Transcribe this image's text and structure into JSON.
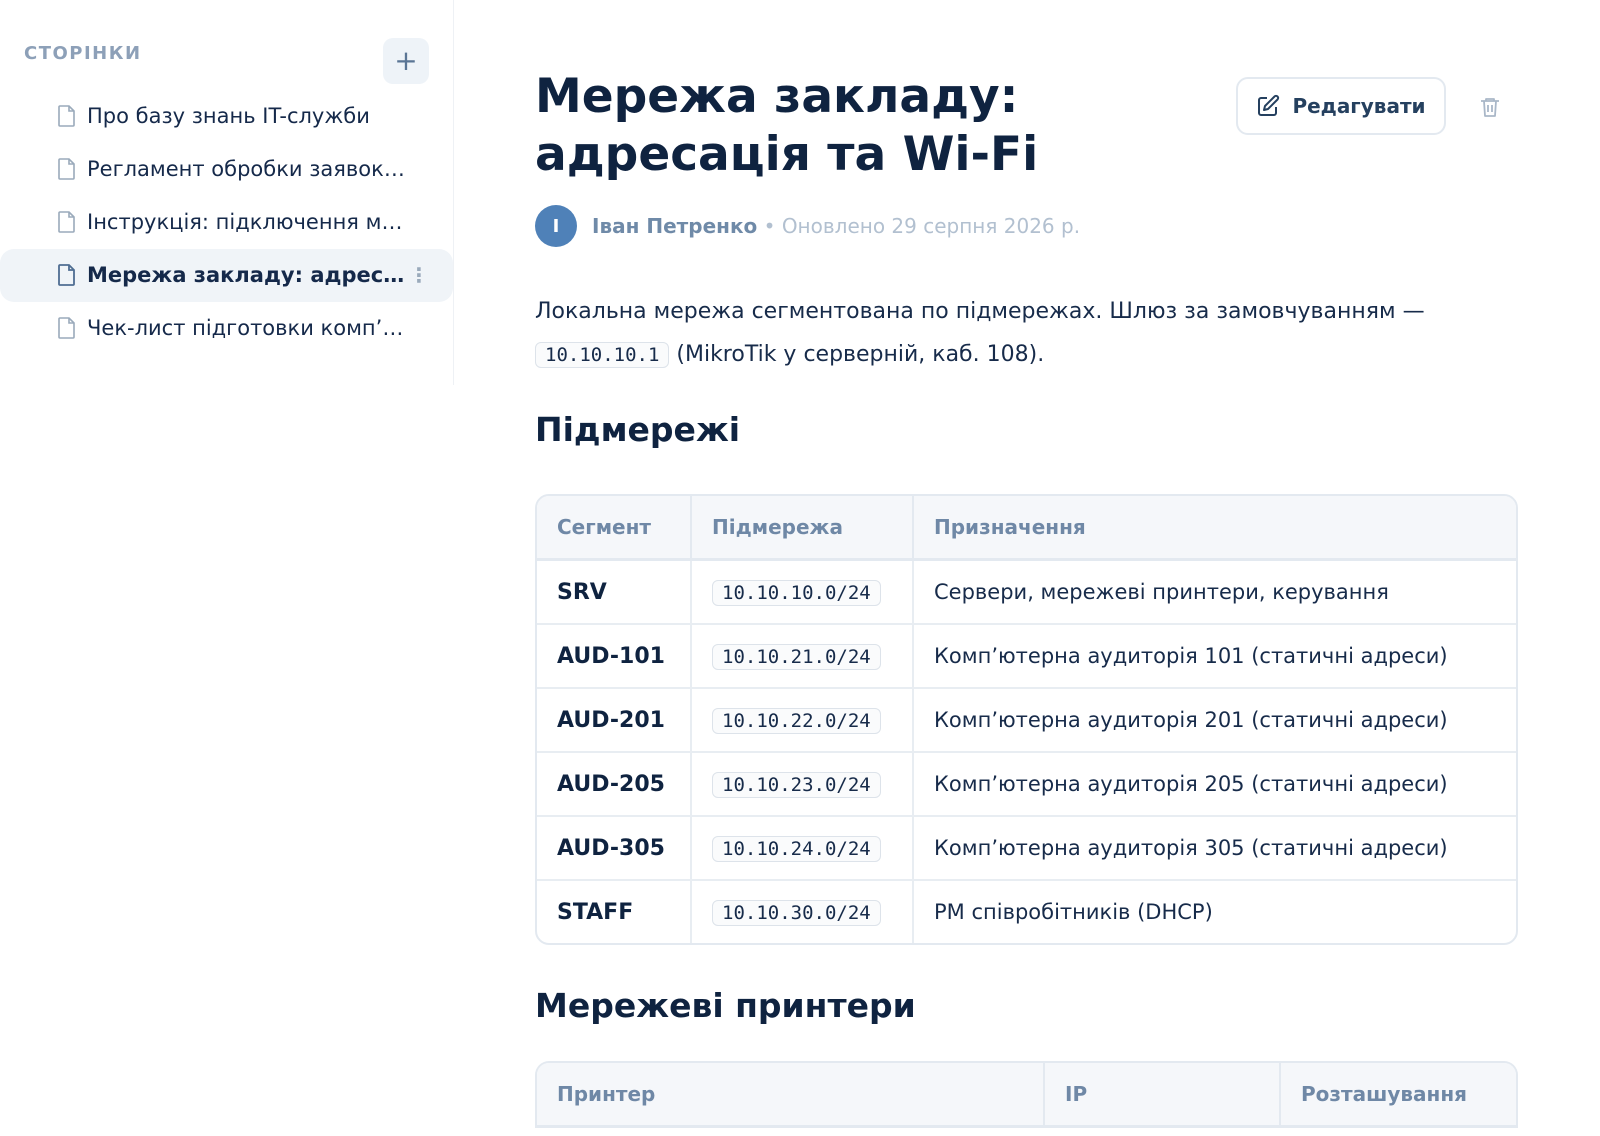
{
  "sidebar": {
    "title": "СТОРІНКИ",
    "add_label": "+",
    "items": [
      {
        "label": "Про базу знань IT-служби"
      },
      {
        "label": "Регламент обробки заявок …"
      },
      {
        "label": "Інструкція: підключення ме…"
      },
      {
        "label": "Мережа закладу: адресац…",
        "active": true
      },
      {
        "label": "Чек-лист підготовки комп’…"
      }
    ],
    "more_label": "⋮"
  },
  "page": {
    "title_line1": "Мережа закладу:",
    "title_line2": "адресація та Wi-Fi",
    "edit_label": "Редагувати",
    "avatar_initial": "І",
    "author": "Іван Петренко",
    "separator": " • ",
    "updated": "Оновлено 29 серпня 2026 р.",
    "intro_text": "Локальна мережа сегментована по підмережах. Шлюз за замовчуванням —",
    "gateway": "10.10.10.1",
    "gateway_note": "(MikroTik у серверній, каб. 108)."
  },
  "subnets": {
    "heading": "Підмережі",
    "columns": [
      "Сегмент",
      "Підмережа",
      "Призначення"
    ],
    "rows": [
      [
        "SRV",
        "10.10.10.0/24",
        "Сервери, мережеві принтери, керування"
      ],
      [
        "AUD-101",
        "10.10.21.0/24",
        "Комп’ютерна аудиторія 101 (статичні адреси)"
      ],
      [
        "AUD-201",
        "10.10.22.0/24",
        "Комп’ютерна аудиторія 201 (статичні адреси)"
      ],
      [
        "AUD-205",
        "10.10.23.0/24",
        "Комп’ютерна аудиторія 205 (статичні адреси)"
      ],
      [
        "AUD-305",
        "10.10.24.0/24",
        "Комп’ютерна аудиторія 305 (статичні адреси)"
      ],
      [
        "STAFF",
        "10.10.30.0/24",
        "РМ співробітників (DHCP)"
      ]
    ]
  },
  "printers": {
    "heading": "Мережеві принтери",
    "columns": [
      "Принтер",
      "IP",
      "Розташування"
    ]
  }
}
